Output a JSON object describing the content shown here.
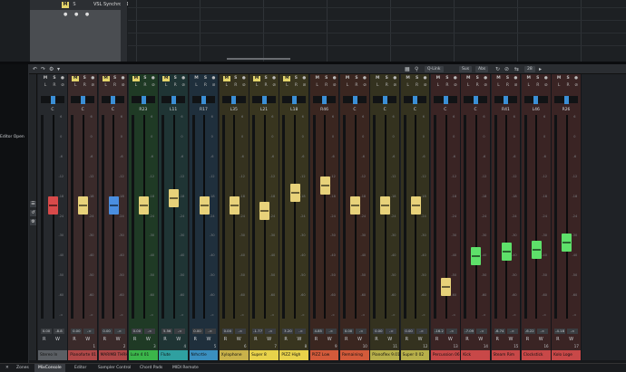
{
  "project": {
    "track_name": "VSL Synchron 1 - Vi7",
    "track_mute": "M",
    "track_solo": "S",
    "track_icons": "● ● ●"
  },
  "sidebar_label": "Editor Open",
  "toolbar": {
    "ch_link": "Q-Link",
    "sus_label": "Sus",
    "abs_label": "Abs",
    "channel_count": "28"
  },
  "colors": {
    "mute_on": "#e3d46a",
    "pan_blue": "#3b8fd6",
    "fader_red": "#d84a4a",
    "fader_yellow": "#e8d27a",
    "fader_blue": "#4a8ee0",
    "fader_green": "#5ee06a"
  },
  "strips": [
    {
      "name": "Stereo In",
      "pan": "C",
      "vol": "0.00",
      "vol2": "-8.8",
      "color": "#5b5f64",
      "bg": "#26292d",
      "fader_color": "#d84a4a",
      "num": "",
      "mute_on": false,
      "level": 0.56
    },
    {
      "name": "Pianoforte 01 (?)",
      "pan": "C",
      "vol": "0.00",
      "vol2": "-∞",
      "color": "#b04848",
      "bg": "#3a2a2a",
      "fader_color": "#e8d27a",
      "num": "1",
      "mute_on": true,
      "level": 0.56
    },
    {
      "name": "MARIMB THRHR",
      "pan": "C",
      "vol": "0.00",
      "vol2": "-∞",
      "color": "#b04848",
      "bg": "#3a2a2a",
      "fader_color": "#4a8ee0",
      "num": "2",
      "mute_on": true,
      "level": 0.56
    },
    {
      "name": "Lute 4 01",
      "pan": "R23",
      "vol": "0.00",
      "vol2": "-∞",
      "color": "#3bb54a",
      "bg": "#1f3a25",
      "fader_color": "#e8d27a",
      "num": "3",
      "mute_on": true,
      "level": 0.56
    },
    {
      "name": "Flute",
      "pan": "L11",
      "vol": "5.56",
      "vol2": "-∞",
      "color": "#2fa0a0",
      "bg": "#1f3434",
      "fader_color": "#e8d27a",
      "num": "4",
      "mute_on": true,
      "level": 0.6
    },
    {
      "name": "Nrhcrtle",
      "pan": "R17",
      "vol": "0.00",
      "vol2": "-∞",
      "color": "#3a8fc0",
      "bg": "#1f2f3c",
      "fader_color": "#e8d27a",
      "num": "5",
      "mute_on": false,
      "level": 0.56
    },
    {
      "name": "Xylophone",
      "pan": "L35",
      "vol": "0.00",
      "vol2": "-∞",
      "color": "#c9b24a",
      "bg": "#35321f",
      "fader_color": "#e8d27a",
      "num": "6",
      "mute_on": true,
      "level": 0.56
    },
    {
      "name": "Super 8",
      "pan": "L21",
      "vol": "-1.77",
      "vol2": "-∞",
      "color": "#e8d24a",
      "bg": "#38351f",
      "fader_color": "#e8d27a",
      "num": "7",
      "mute_on": true,
      "level": 0.53
    },
    {
      "name": "PIZZ High",
      "pan": "L18",
      "vol": "3.20",
      "vol2": "-∞",
      "color": "#e8d24a",
      "bg": "#38351f",
      "fader_color": "#e8d27a",
      "num": "8",
      "mute_on": true,
      "level": 0.63
    },
    {
      "name": "PIZZ Low",
      "pan": "R46",
      "vol": "4.85",
      "vol2": "-∞",
      "color": "#d35a3a",
      "bg": "#3a2620",
      "fader_color": "#e8d27a",
      "num": "9",
      "mute_on": false,
      "level": 0.67
    },
    {
      "name": "Remaining",
      "pan": "C",
      "vol": "0.00",
      "vol2": "-∞",
      "color": "#d35a3a",
      "bg": "#3a2620",
      "fader_color": "#e8d27a",
      "num": "10",
      "mute_on": false,
      "level": 0.56
    },
    {
      "name": "Pianoflex 9.01 (2)",
      "pan": "C",
      "vol": "0.00",
      "vol2": "-∞",
      "color": "#b8b04a",
      "bg": "#34321f",
      "fader_color": "#e8d27a",
      "num": "11",
      "mute_on": false,
      "level": 0.56
    },
    {
      "name": "Super 0 02",
      "pan": "C",
      "vol": "0.00",
      "vol2": "-∞",
      "color": "#b8b04a",
      "bg": "#34321f",
      "fader_color": "#e8d27a",
      "num": "12",
      "mute_on": false,
      "level": 0.56
    },
    {
      "name": "Percussion 06",
      "pan": "C",
      "vol": "-16.2",
      "vol2": "-∞",
      "color": "#c84848",
      "bg": "#3a2424",
      "fader_color": "#e8d27a",
      "num": "13",
      "mute_on": false,
      "level": 0.12
    },
    {
      "name": "Kick",
      "pan": "C",
      "vol": "-7.09",
      "vol2": "-∞",
      "color": "#c84848",
      "bg": "#3a2424",
      "fader_color": "#5ee06a",
      "num": "14",
      "mute_on": false,
      "level": 0.29
    },
    {
      "name": "Steam Rim",
      "pan": "R41",
      "vol": "-6.74",
      "vol2": "-∞",
      "color": "#c84848",
      "bg": "#3a2424",
      "fader_color": "#5ee06a",
      "num": "15",
      "mute_on": false,
      "level": 0.31
    },
    {
      "name": "Clockstick",
      "pan": "L46",
      "vol": "-6.22",
      "vol2": "-∞",
      "color": "#c84848",
      "bg": "#3a2424",
      "fader_color": "#5ee06a",
      "num": "16",
      "mute_on": false,
      "level": 0.32
    },
    {
      "name": "Kolo Loge",
      "pan": "R26",
      "vol": "-4.18",
      "vol2": "-∞",
      "color": "#c84848",
      "bg": "#3a2424",
      "fader_color": "#5ee06a",
      "num": "17",
      "mute_on": false,
      "level": 0.36
    }
  ],
  "scale_ticks": [
    "6",
    "0",
    "-6",
    "-12",
    "-18",
    "-24",
    "-30",
    "-40",
    "-50",
    "-60",
    "-∞"
  ],
  "bottom_tabs": [
    "Zones",
    "MixConsole",
    "Editor",
    "Sampler Control",
    "Chord Pads",
    "MIDI Remote"
  ],
  "active_tab": "MixConsole"
}
